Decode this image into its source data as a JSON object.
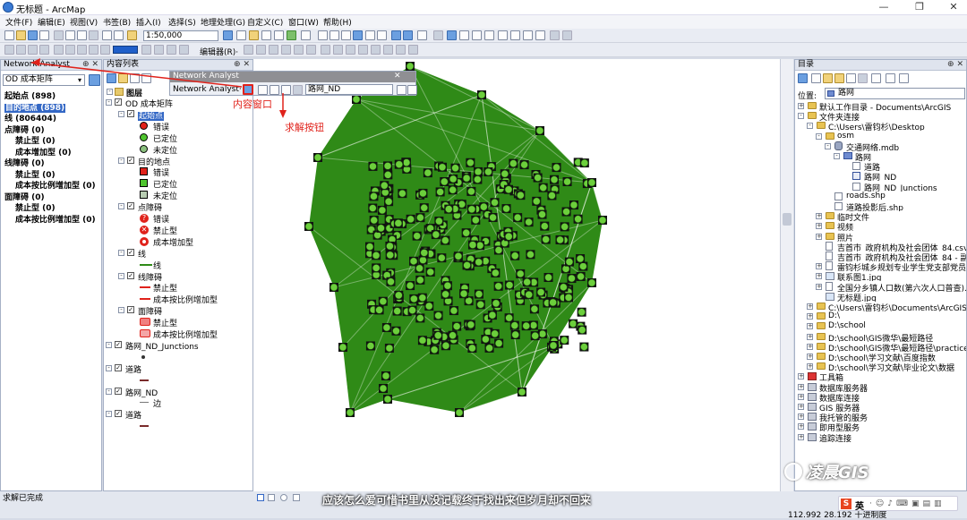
{
  "window": {
    "title": "无标题 - ArcMap"
  },
  "menu": [
    "文件(F)",
    "编辑(E)",
    "视图(V)",
    "书签(B)",
    "插入(I)",
    "选择(S)",
    "地理处理(G)",
    "自定义(C)",
    "窗口(W)",
    "帮助(H)"
  ],
  "toolbar": {
    "scale": "1:50,000",
    "editor_label": "编辑器(R)·"
  },
  "na_panel": {
    "title": "Network Analyst",
    "dropdown": "OD 成本矩阵",
    "items": [
      {
        "label": "起始点 (898)",
        "bold": true,
        "indent": 0
      },
      {
        "label": "目的地点 (898)",
        "bold": true,
        "indent": 0,
        "selected": true
      },
      {
        "label": "线 (806404)",
        "bold": true,
        "indent": 0
      },
      {
        "label": "点障碍 (0)",
        "bold": true,
        "indent": 0
      },
      {
        "label": "禁止型 (0)",
        "bold": true,
        "indent": 1
      },
      {
        "label": "成本增加型 (0)",
        "bold": true,
        "indent": 1
      },
      {
        "label": "线障碍 (0)",
        "bold": true,
        "indent": 0
      },
      {
        "label": "禁止型 (0)",
        "bold": true,
        "indent": 1
      },
      {
        "label": "成本按比例增加型 (0)",
        "bold": true,
        "indent": 1
      },
      {
        "label": "面障碍 (0)",
        "bold": true,
        "indent": 0
      },
      {
        "label": "禁止型 (0)",
        "bold": true,
        "indent": 1
      },
      {
        "label": "成本按比例增加型 (0)",
        "bold": true,
        "indent": 1
      }
    ]
  },
  "toc": {
    "title": "内容列表",
    "root": "图层",
    "rows": [
      {
        "label": "OD 成本矩阵",
        "level": 1,
        "cb": true,
        "pm": "-"
      },
      {
        "label": "起始点",
        "level": 2,
        "cb": true,
        "pm": "-",
        "selected": true
      },
      {
        "label": "错误",
        "level": 3,
        "sym": "red-circle"
      },
      {
        "label": "已定位",
        "level": 3,
        "sym": "green-circle"
      },
      {
        "label": "未定位",
        "level": 3,
        "sym": "gray-circle-q"
      },
      {
        "label": "目的地点",
        "level": 2,
        "cb": true,
        "pm": "-"
      },
      {
        "label": "错误",
        "level": 3,
        "sym": "red-square"
      },
      {
        "label": "已定位",
        "level": 3,
        "sym": "green-square"
      },
      {
        "label": "未定位",
        "level": 3,
        "sym": "gray-square-q"
      },
      {
        "label": "点障碍",
        "level": 2,
        "cb": true,
        "pm": "-"
      },
      {
        "label": "错误",
        "level": 3,
        "sym": "red-q"
      },
      {
        "label": "禁止型",
        "level": 3,
        "sym": "red-x"
      },
      {
        "label": "成本增加型",
        "level": 3,
        "sym": "red-ring"
      },
      {
        "label": "线",
        "level": 2,
        "cb": true,
        "pm": "-"
      },
      {
        "label": "线",
        "level": 3,
        "sym": "green-line"
      },
      {
        "label": "线障碍",
        "level": 2,
        "cb": true,
        "pm": "-"
      },
      {
        "label": "禁止型",
        "level": 3,
        "sym": "red-line"
      },
      {
        "label": "成本按比例增加型",
        "level": 3,
        "sym": "red-line-dot"
      },
      {
        "label": "面障碍",
        "level": 2,
        "cb": true,
        "pm": "-"
      },
      {
        "label": "禁止型",
        "level": 3,
        "sym": "red-poly"
      },
      {
        "label": "成本按比例增加型",
        "level": 3,
        "sym": "red-poly2"
      },
      {
        "label": "路网_ND_Junctions",
        "level": 1,
        "cb": true,
        "pm": "-"
      },
      {
        "label": "",
        "level": 3,
        "sym": "dot"
      },
      {
        "label": "道路",
        "level": 1,
        "cb": true,
        "pm": "-"
      },
      {
        "label": "",
        "level": 3,
        "sym": "dark-line"
      },
      {
        "label": "路网_ND",
        "level": 1,
        "cb": true,
        "pm": "-"
      },
      {
        "label": "边",
        "level": 3,
        "sym": "gray-line"
      },
      {
        "label": "道路",
        "level": 1,
        "cb": true,
        "pm": "-"
      },
      {
        "label": "",
        "level": 3,
        "sym": "dark-line"
      }
    ]
  },
  "na_window": {
    "title": "Network Analyst",
    "label": "Network Analyst·",
    "network": "路网_ND"
  },
  "annotations": {
    "content": "内容窗口",
    "solve": "求解按钮"
  },
  "catalog": {
    "title": "目录",
    "location_label": "位置:",
    "location_value": "路网",
    "rows": [
      {
        "label": "默认工作目录 - Documents\\ArcGIS",
        "level": 0,
        "icon": "folder",
        "pm": "+"
      },
      {
        "label": "文件夹连接",
        "level": 0,
        "icon": "folder",
        "pm": "-"
      },
      {
        "label": "C:\\Users\\雷钧杉\\Desktop",
        "level": 1,
        "icon": "folder",
        "pm": "-"
      },
      {
        "label": "osm",
        "level": 2,
        "icon": "folder",
        "pm": "-"
      },
      {
        "label": "交通网络.mdb",
        "level": 3,
        "icon": "db",
        "pm": "-"
      },
      {
        "label": "路网",
        "level": 4,
        "icon": "dataset",
        "pm": "-"
      },
      {
        "label": "道路",
        "level": 5,
        "icon": "line"
      },
      {
        "label": "路网_ND",
        "level": 5,
        "icon": "nd"
      },
      {
        "label": "路网_ND_Junctions",
        "level": 5,
        "icon": "point"
      },
      {
        "label": "roads.shp",
        "level": 3,
        "icon": "line"
      },
      {
        "label": "道路投影后.shp",
        "level": 3,
        "icon": "line"
      },
      {
        "label": "临时文件",
        "level": 2,
        "icon": "folder",
        "pm": "+"
      },
      {
        "label": "视频",
        "level": 2,
        "icon": "folder",
        "pm": "+"
      },
      {
        "label": "照片",
        "level": 2,
        "icon": "folder",
        "pm": "+"
      },
      {
        "label": "吉首市_政府机构及社会团体_84.csv",
        "level": 2,
        "icon": "file"
      },
      {
        "label": "吉首市_政府机构及社会团体_84 - 副本",
        "level": 2,
        "icon": "file"
      },
      {
        "label": "雷钧杉城乡规划专业学生党支部党员获",
        "level": 2,
        "icon": "file",
        "pm": "+"
      },
      {
        "label": "联系图1.jpg",
        "level": 2,
        "icon": "img",
        "pm": "+"
      },
      {
        "label": "全国分乡镇人口数(第六次人口普查).xl",
        "level": 2,
        "icon": "file",
        "pm": "+"
      },
      {
        "label": "无标题.jpg",
        "level": 2,
        "icon": "img"
      },
      {
        "label": "C:\\Users\\雷钧杉\\Documents\\ArcGIS\\",
        "level": 1,
        "icon": "folder",
        "pm": "+"
      },
      {
        "label": "D:\\",
        "level": 1,
        "icon": "folder",
        "pm": "+"
      },
      {
        "label": "D:\\school",
        "level": 1,
        "icon": "folder",
        "pm": "+"
      },
      {
        "label": "D:\\school\\GIS微华\\最短路径",
        "level": 1,
        "icon": "folder",
        "pm": "+"
      },
      {
        "label": "D:\\school\\GIS微华\\最短路径\\practice",
        "level": 1,
        "icon": "folder",
        "pm": "+"
      },
      {
        "label": "D:\\school\\学习文献\\百度指数",
        "level": 1,
        "icon": "folder",
        "pm": "+"
      },
      {
        "label": "D:\\school\\学习文献\\毕业论文\\数据",
        "level": 1,
        "icon": "folder",
        "pm": "+"
      },
      {
        "label": "工具箱",
        "level": 0,
        "icon": "tool",
        "pm": "+"
      },
      {
        "label": "数据库服务器",
        "level": 0,
        "icon": "server",
        "pm": "+"
      },
      {
        "label": "数据库连接",
        "level": 0,
        "icon": "server",
        "pm": "+"
      },
      {
        "label": "GIS 服务器",
        "level": 0,
        "icon": "server",
        "pm": "+"
      },
      {
        "label": "我托管的服务",
        "level": 0,
        "icon": "server",
        "pm": "+"
      },
      {
        "label": "即用型服务",
        "level": 0,
        "icon": "server",
        "pm": "+"
      },
      {
        "label": "追踪连接",
        "level": 0,
        "icon": "server",
        "pm": "+"
      }
    ]
  },
  "status": {
    "left": "求解已完成",
    "coords": "112.992  28.192 十进制度"
  },
  "caption": "应该怎么爱可惜书里从没记载终于找出来但岁月却不回来",
  "watermark": "凌晨GIS",
  "colors": {
    "network_green": "#2f8a17",
    "point_green": "#6ccf3c",
    "accent_red": "#e0221b",
    "selection_blue": "#3367c5"
  }
}
